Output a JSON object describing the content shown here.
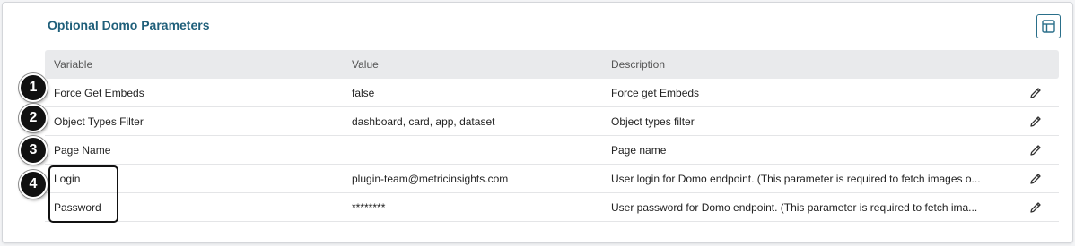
{
  "section": {
    "title": "Optional Domo Parameters",
    "layout_icon": "table-layout-icon"
  },
  "table": {
    "headers": [
      "Variable",
      "Value",
      "Description"
    ],
    "rows": [
      {
        "variable": "Force Get Embeds",
        "value": "false",
        "description": "Force get Embeds"
      },
      {
        "variable": "Object Types Filter",
        "value": "dashboard, card, app, dataset",
        "description": "Object types filter"
      },
      {
        "variable": "Page Name",
        "value": "",
        "description": "Page name"
      },
      {
        "variable": "Login",
        "value": "plugin-team@metricinsights.com",
        "description": "User login for Domo endpoint. (This parameter is required to fetch images o..."
      },
      {
        "variable": "Password",
        "value": "********",
        "description": "User password for Domo endpoint. (This parameter is required to fetch ima..."
      }
    ],
    "edit_icon": "pencil-icon"
  },
  "annotations": {
    "badges": [
      "1",
      "2",
      "3",
      "4"
    ]
  },
  "colors": {
    "accent": "#1f5f7a",
    "header_bg": "#e9eaec",
    "badge": "#111111"
  }
}
